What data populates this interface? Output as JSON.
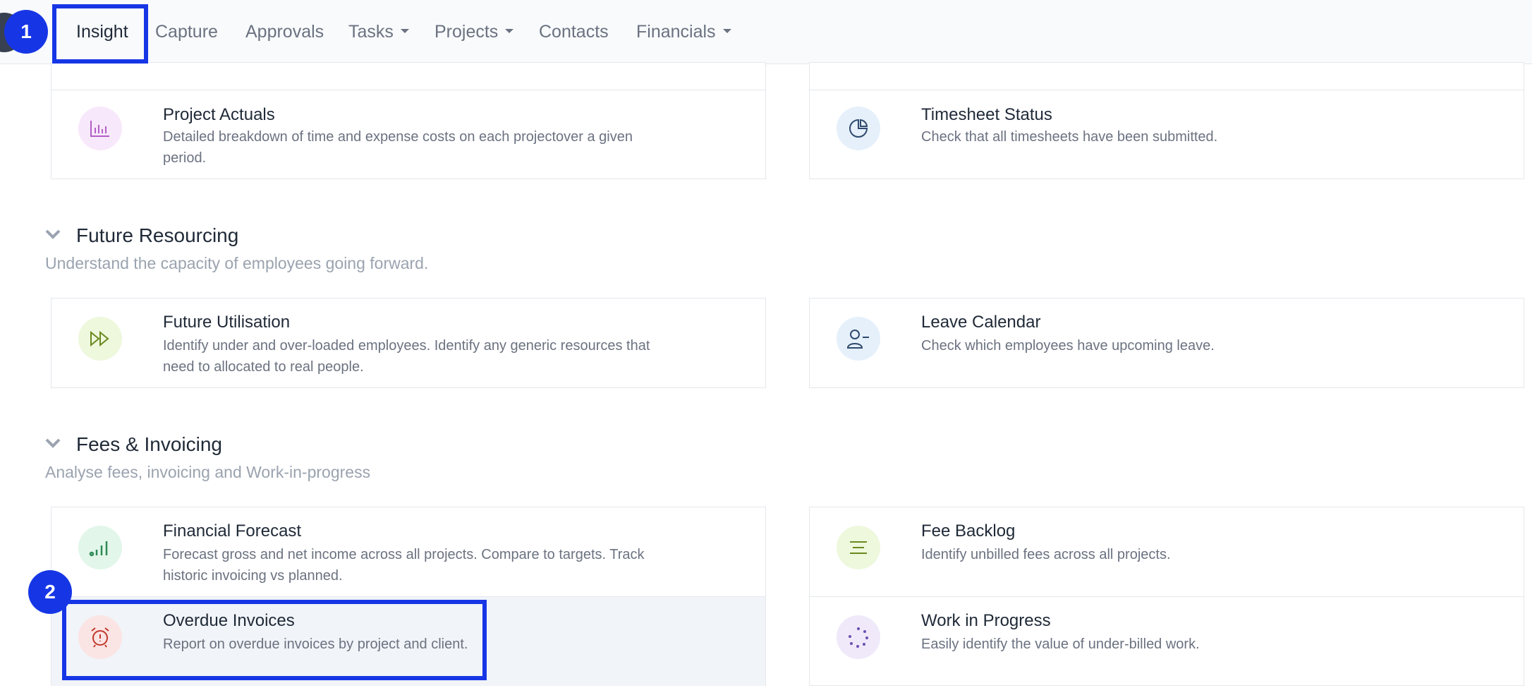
{
  "nav": {
    "items": [
      {
        "label": "Insight",
        "dropdown": false,
        "active": true
      },
      {
        "label": "Capture",
        "dropdown": false
      },
      {
        "label": "Approvals",
        "dropdown": false
      },
      {
        "label": "Tasks",
        "dropdown": true
      },
      {
        "label": "Projects",
        "dropdown": true
      },
      {
        "label": "Contacts",
        "dropdown": false
      },
      {
        "label": "Financials",
        "dropdown": true
      }
    ]
  },
  "annotations": {
    "badge1": "1",
    "badge2": "2"
  },
  "top_cards": {
    "left": {
      "title": "Project Actuals",
      "desc": "Detailed breakdown of time and expense costs on each projectover a given period.",
      "icon": "bar-chart-icon"
    },
    "right": {
      "title": "Timesheet Status",
      "desc": "Check that all timesheets have been submitted.",
      "icon": "pie-chart-icon"
    }
  },
  "future_resourcing": {
    "title": "Future Resourcing",
    "subtitle": "Understand the capacity of employees going forward.",
    "left": {
      "title": "Future Utilisation",
      "desc": "Identify under and over-loaded employees. Identify any generic resources that need to allocated to real people.",
      "icon": "fast-forward-icon"
    },
    "right": {
      "title": "Leave Calendar",
      "desc": "Check which employees have upcoming leave.",
      "icon": "user-minus-icon"
    }
  },
  "fees_invoicing": {
    "title": "Fees & Invoicing",
    "subtitle": "Analyse fees, invoicing and Work-in-progress",
    "left": [
      {
        "title": "Financial Forecast",
        "desc": "Forecast gross and net income across all projects. Compare to targets. Track historic invoicing vs planned.",
        "icon": "signal-bars-icon"
      },
      {
        "title": "Overdue Invoices",
        "desc": "Report on overdue invoices by project and client.",
        "icon": "alarm-clock-icon"
      }
    ],
    "right": [
      {
        "title": "Fee Backlog",
        "desc": "Identify unbilled fees across all projects.",
        "icon": "align-center-icon"
      },
      {
        "title": "Work in Progress",
        "desc": "Easily identify the value of under-billed work.",
        "icon": "loader-dots-icon"
      }
    ]
  },
  "colors": {
    "accent_annotation": "#1636e6",
    "icon_purple_bg": "#f8e8fb",
    "icon_blue_bg": "#e5f0fb",
    "icon_lime_bg": "#eef8dd",
    "icon_green_bg": "#e2f6ea",
    "icon_red_bg": "#fbe4e4",
    "icon_violet_bg": "#efe9fa"
  }
}
